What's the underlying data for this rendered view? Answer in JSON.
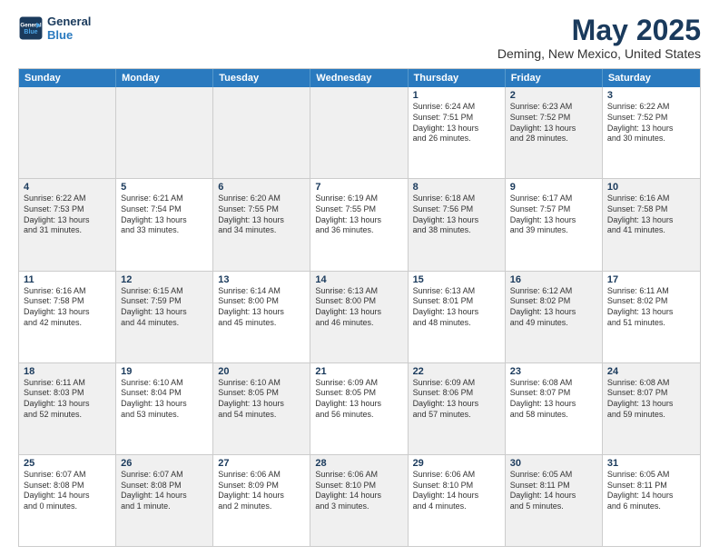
{
  "logo": {
    "line1": "General",
    "line2": "Blue"
  },
  "title": "May 2025",
  "subtitle": "Deming, New Mexico, United States",
  "days": [
    "Sunday",
    "Monday",
    "Tuesday",
    "Wednesday",
    "Thursday",
    "Friday",
    "Saturday"
  ],
  "weeks": [
    [
      {
        "day": "",
        "info": "",
        "shaded": true
      },
      {
        "day": "",
        "info": "",
        "shaded": true
      },
      {
        "day": "",
        "info": "",
        "shaded": true
      },
      {
        "day": "",
        "info": "",
        "shaded": true
      },
      {
        "day": "1",
        "info": "Sunrise: 6:24 AM\nSunset: 7:51 PM\nDaylight: 13 hours\nand 26 minutes."
      },
      {
        "day": "2",
        "info": "Sunrise: 6:23 AM\nSunset: 7:52 PM\nDaylight: 13 hours\nand 28 minutes.",
        "shaded": true
      },
      {
        "day": "3",
        "info": "Sunrise: 6:22 AM\nSunset: 7:52 PM\nDaylight: 13 hours\nand 30 minutes."
      }
    ],
    [
      {
        "day": "4",
        "info": "Sunrise: 6:22 AM\nSunset: 7:53 PM\nDaylight: 13 hours\nand 31 minutes.",
        "shaded": true
      },
      {
        "day": "5",
        "info": "Sunrise: 6:21 AM\nSunset: 7:54 PM\nDaylight: 13 hours\nand 33 minutes."
      },
      {
        "day": "6",
        "info": "Sunrise: 6:20 AM\nSunset: 7:55 PM\nDaylight: 13 hours\nand 34 minutes.",
        "shaded": true
      },
      {
        "day": "7",
        "info": "Sunrise: 6:19 AM\nSunset: 7:55 PM\nDaylight: 13 hours\nand 36 minutes."
      },
      {
        "day": "8",
        "info": "Sunrise: 6:18 AM\nSunset: 7:56 PM\nDaylight: 13 hours\nand 38 minutes.",
        "shaded": true
      },
      {
        "day": "9",
        "info": "Sunrise: 6:17 AM\nSunset: 7:57 PM\nDaylight: 13 hours\nand 39 minutes."
      },
      {
        "day": "10",
        "info": "Sunrise: 6:16 AM\nSunset: 7:58 PM\nDaylight: 13 hours\nand 41 minutes.",
        "shaded": true
      }
    ],
    [
      {
        "day": "11",
        "info": "Sunrise: 6:16 AM\nSunset: 7:58 PM\nDaylight: 13 hours\nand 42 minutes."
      },
      {
        "day": "12",
        "info": "Sunrise: 6:15 AM\nSunset: 7:59 PM\nDaylight: 13 hours\nand 44 minutes.",
        "shaded": true
      },
      {
        "day": "13",
        "info": "Sunrise: 6:14 AM\nSunset: 8:00 PM\nDaylight: 13 hours\nand 45 minutes."
      },
      {
        "day": "14",
        "info": "Sunrise: 6:13 AM\nSunset: 8:00 PM\nDaylight: 13 hours\nand 46 minutes.",
        "shaded": true
      },
      {
        "day": "15",
        "info": "Sunrise: 6:13 AM\nSunset: 8:01 PM\nDaylight: 13 hours\nand 48 minutes."
      },
      {
        "day": "16",
        "info": "Sunrise: 6:12 AM\nSunset: 8:02 PM\nDaylight: 13 hours\nand 49 minutes.",
        "shaded": true
      },
      {
        "day": "17",
        "info": "Sunrise: 6:11 AM\nSunset: 8:02 PM\nDaylight: 13 hours\nand 51 minutes."
      }
    ],
    [
      {
        "day": "18",
        "info": "Sunrise: 6:11 AM\nSunset: 8:03 PM\nDaylight: 13 hours\nand 52 minutes.",
        "shaded": true
      },
      {
        "day": "19",
        "info": "Sunrise: 6:10 AM\nSunset: 8:04 PM\nDaylight: 13 hours\nand 53 minutes."
      },
      {
        "day": "20",
        "info": "Sunrise: 6:10 AM\nSunset: 8:05 PM\nDaylight: 13 hours\nand 54 minutes.",
        "shaded": true
      },
      {
        "day": "21",
        "info": "Sunrise: 6:09 AM\nSunset: 8:05 PM\nDaylight: 13 hours\nand 56 minutes."
      },
      {
        "day": "22",
        "info": "Sunrise: 6:09 AM\nSunset: 8:06 PM\nDaylight: 13 hours\nand 57 minutes.",
        "shaded": true
      },
      {
        "day": "23",
        "info": "Sunrise: 6:08 AM\nSunset: 8:07 PM\nDaylight: 13 hours\nand 58 minutes."
      },
      {
        "day": "24",
        "info": "Sunrise: 6:08 AM\nSunset: 8:07 PM\nDaylight: 13 hours\nand 59 minutes.",
        "shaded": true
      }
    ],
    [
      {
        "day": "25",
        "info": "Sunrise: 6:07 AM\nSunset: 8:08 PM\nDaylight: 14 hours\nand 0 minutes."
      },
      {
        "day": "26",
        "info": "Sunrise: 6:07 AM\nSunset: 8:08 PM\nDaylight: 14 hours\nand 1 minute.",
        "shaded": true
      },
      {
        "day": "27",
        "info": "Sunrise: 6:06 AM\nSunset: 8:09 PM\nDaylight: 14 hours\nand 2 minutes."
      },
      {
        "day": "28",
        "info": "Sunrise: 6:06 AM\nSunset: 8:10 PM\nDaylight: 14 hours\nand 3 minutes.",
        "shaded": true
      },
      {
        "day": "29",
        "info": "Sunrise: 6:06 AM\nSunset: 8:10 PM\nDaylight: 14 hours\nand 4 minutes."
      },
      {
        "day": "30",
        "info": "Sunrise: 6:05 AM\nSunset: 8:11 PM\nDaylight: 14 hours\nand 5 minutes.",
        "shaded": true
      },
      {
        "day": "31",
        "info": "Sunrise: 6:05 AM\nSunset: 8:11 PM\nDaylight: 14 hours\nand 6 minutes."
      }
    ]
  ]
}
